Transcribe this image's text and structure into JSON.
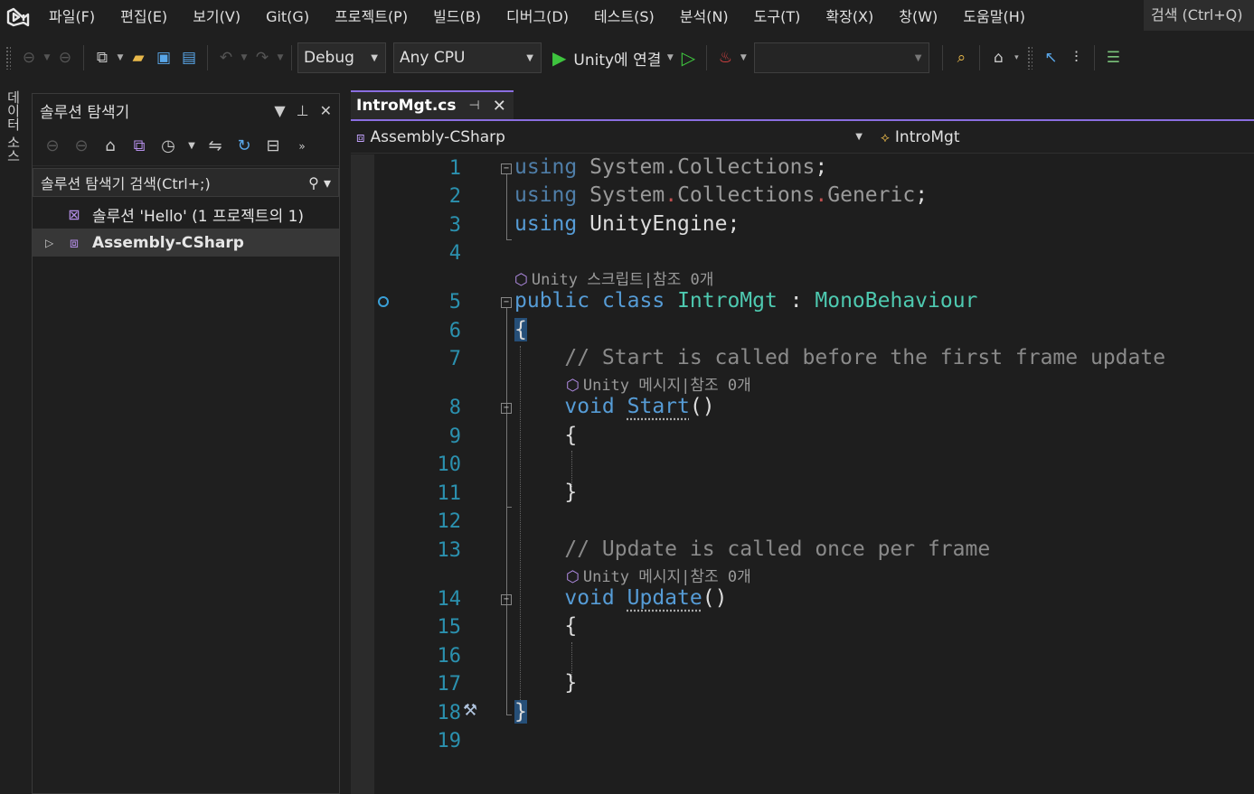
{
  "menu": {
    "items": [
      "파일(F)",
      "편집(E)",
      "보기(V)",
      "Git(G)",
      "프로젝트(P)",
      "빌드(B)",
      "디버그(D)",
      "테스트(S)",
      "분석(N)",
      "도구(T)",
      "확장(X)",
      "창(W)",
      "도움말(H)"
    ],
    "search_label": "검색 (Ctrl+Q)"
  },
  "toolbar": {
    "config": "Debug",
    "platform": "Any CPU",
    "run_label": "Unity에 연결",
    "icons": [
      "back-icon",
      "forward-icon",
      "new-project-icon",
      "open-folder-icon",
      "save-icon",
      "save-all-icon",
      "undo-icon",
      "redo-icon",
      "play-icon",
      "hot-reload-icon"
    ]
  },
  "side_tab": {
    "label": "데이터 소스"
  },
  "solution_explorer": {
    "title": "솔루션 탐색기",
    "search_placeholder": "솔루션 탐색기 검색(Ctrl+;)",
    "solution_label": "솔루션 'Hello' (1 프로젝트의 1)",
    "project_label": "Assembly-CSharp"
  },
  "editor": {
    "tab_label": "IntroMgt.cs",
    "nav_project": "Assembly-CSharp",
    "nav_class": "IntroMgt",
    "line_numbers": [
      "1",
      "2",
      "3",
      "4",
      "5",
      "6",
      "7",
      "8",
      "9",
      "10",
      "11",
      "12",
      "13",
      "14",
      "15",
      "16",
      "17",
      "18",
      "19"
    ],
    "code": {
      "l1_kw": "using",
      "l1_ns": "System",
      "l1_ns2": "Collections",
      "l2_kw": "using",
      "l2_ns": "System",
      "l2_ns2": "Collections",
      "l2_ns3": "Generic",
      "l3_kw": "using",
      "l3_ns": "UnityEngine",
      "l5_kw1": "public",
      "l5_kw2": "class",
      "l5_class": "IntroMgt",
      "l5_base": "MonoBehaviour",
      "l7_comment": "// Start is called before the first frame update",
      "l8_kw": "void",
      "l8_fn": "Start",
      "l13_comment": "// Update is called once per frame",
      "l14_kw": "void",
      "l14_fn": "Update"
    },
    "lens_class": "Unity 스크립트|참조 0개",
    "lens_start": "Unity 메시지|참조 0개",
    "lens_update": "Unity 메시지|참조 0개"
  }
}
